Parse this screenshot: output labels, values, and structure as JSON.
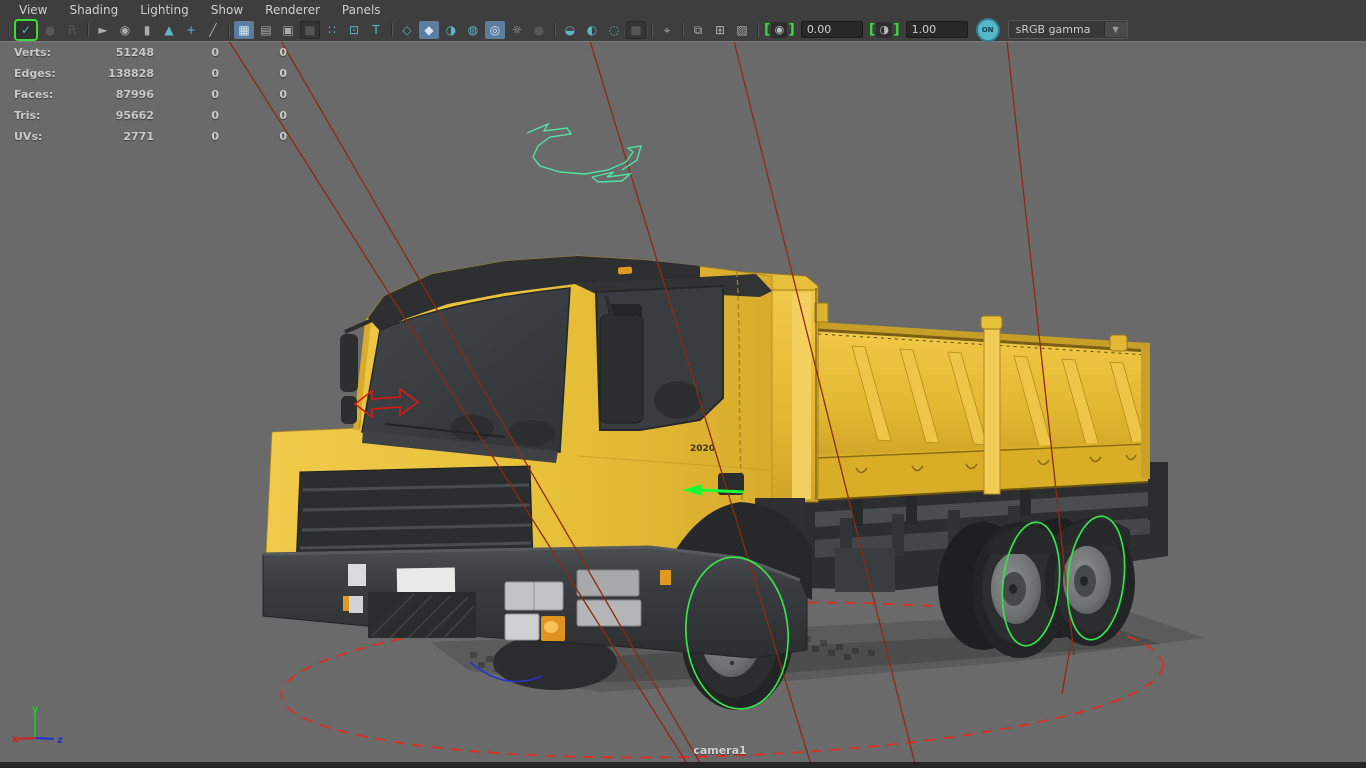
{
  "menu_bar": {
    "items": [
      "View",
      "Shading",
      "Lighting",
      "Show",
      "Renderer",
      "Panels"
    ]
  },
  "toolbar": {
    "items": [
      {
        "kind": "sep"
      },
      {
        "kind": "icon",
        "name": "look-through-selected-icon",
        "glyph": "✓",
        "state": "green-border"
      },
      {
        "kind": "icon",
        "name": "render-region-icon",
        "glyph": "●",
        "state": "dim"
      },
      {
        "kind": "icon",
        "name": "snapshot-icon",
        "glyph": "R",
        "state": "dim"
      },
      {
        "kind": "sep"
      },
      {
        "kind": "icon",
        "name": "select-camera-icon",
        "glyph": "►",
        "state": "gray"
      },
      {
        "kind": "icon",
        "name": "camera-attributes-icon",
        "glyph": "◉",
        "state": "gray"
      },
      {
        "kind": "icon",
        "name": "bookmark-icon",
        "glyph": "▮",
        "state": "gray"
      },
      {
        "kind": "icon",
        "name": "image-plane-icon",
        "glyph": "▲",
        "state": "teal"
      },
      {
        "kind": "icon",
        "name": "pan-zoom-icon",
        "glyph": "+",
        "state": "teal"
      },
      {
        "kind": "icon",
        "name": "measure-tool-icon",
        "glyph": "╱",
        "state": "gray"
      },
      {
        "kind": "sep"
      },
      {
        "kind": "icon",
        "name": "grid-icon",
        "glyph": "▦",
        "state": "active"
      },
      {
        "kind": "icon",
        "name": "film-gate-icon",
        "glyph": "▤",
        "state": "gray"
      },
      {
        "kind": "icon",
        "name": "resolution-gate-icon",
        "glyph": "▣",
        "state": "gray"
      },
      {
        "kind": "icon",
        "name": "gate-mask-icon",
        "glyph": "■",
        "state": "pressed"
      },
      {
        "kind": "icon",
        "name": "field-chart-icon",
        "glyph": "∷",
        "state": "teal"
      },
      {
        "kind": "icon",
        "name": "safe-action-icon",
        "glyph": "⊡",
        "state": "teal"
      },
      {
        "kind": "icon",
        "name": "safe-title-icon",
        "glyph": "T",
        "state": "teal"
      },
      {
        "kind": "sep"
      },
      {
        "kind": "icon",
        "name": "wireframe-icon",
        "glyph": "◇",
        "state": "teal"
      },
      {
        "kind": "icon",
        "name": "smooth-shade-icon",
        "glyph": "◆",
        "state": "active"
      },
      {
        "kind": "icon",
        "name": "flat-shade-icon",
        "glyph": "◑",
        "state": "teal"
      },
      {
        "kind": "icon",
        "name": "textured-icon",
        "glyph": "◍",
        "state": "teal"
      },
      {
        "kind": "icon",
        "name": "use-all-lights-icon",
        "glyph": "◎",
        "state": "active"
      },
      {
        "kind": "icon",
        "name": "default-lighting-icon",
        "glyph": "☼",
        "state": "gray"
      },
      {
        "kind": "icon",
        "name": "shadows-icon",
        "glyph": "●",
        "state": "dim"
      },
      {
        "kind": "sep"
      },
      {
        "kind": "icon",
        "name": "occlusion-icon",
        "glyph": "◒",
        "state": "teal"
      },
      {
        "kind": "icon",
        "name": "motion-blur-icon",
        "glyph": "◐",
        "state": "teal"
      },
      {
        "kind": "icon",
        "name": "anti-alias-icon",
        "glyph": "◌",
        "state": "teal"
      },
      {
        "kind": "icon",
        "name": "depth-of-field-icon",
        "glyph": "■",
        "state": "pressed"
      },
      {
        "kind": "sep"
      },
      {
        "kind": "icon",
        "name": "object-select-icon",
        "glyph": "⌖",
        "state": "gray"
      },
      {
        "kind": "sep"
      },
      {
        "kind": "icon",
        "name": "isolate-select-icon",
        "glyph": "⧉",
        "state": "gray"
      },
      {
        "kind": "icon",
        "name": "tear-off-copy-icon",
        "glyph": "⊞",
        "state": "gray"
      },
      {
        "kind": "icon",
        "name": "image-output-icon",
        "glyph": "▨",
        "state": "gray"
      },
      {
        "kind": "sep"
      },
      {
        "kind": "bracket",
        "name": "exposure-icon",
        "glyph": "◉"
      },
      {
        "kind": "field",
        "name": "exposure-field",
        "value": "0.00"
      },
      {
        "kind": "bracket",
        "name": "contrast-icon",
        "glyph": "◑"
      },
      {
        "kind": "field",
        "name": "contrast-field",
        "value": "1.00"
      },
      {
        "kind": "toggle",
        "name": "gamma-toggle",
        "label": "ON"
      },
      {
        "kind": "dropdown",
        "name": "colorspace-dropdown",
        "label": "sRGB gamma"
      }
    ]
  },
  "hud": {
    "rows": [
      {
        "label": "Verts:",
        "value": "51248",
        "col1": "0",
        "col2": "0"
      },
      {
        "label": "Edges:",
        "value": "138828",
        "col1": "0",
        "col2": "0"
      },
      {
        "label": "Faces:",
        "value": "87996",
        "col1": "0",
        "col2": "0"
      },
      {
        "label": "Tris:",
        "value": "95662",
        "col1": "0",
        "col2": "0"
      },
      {
        "label": "UVs:",
        "value": "2771",
        "col1": "0",
        "col2": "0"
      }
    ]
  },
  "viewport": {
    "camera_label": "camera1",
    "truck_door_label": "2020",
    "axis": {
      "x": "x",
      "y": "y",
      "z": "z"
    },
    "colors": {
      "background": "#6a6a6a",
      "truck_yellow": "#e8c13a",
      "cab_dark": "#2d2f31",
      "selection_green": "#35e44b",
      "curve_teal": "#4fe2a0",
      "frustum_red": "#8c2a12",
      "dashed_red": "#de2e1e",
      "annotation_red": "#d81b12",
      "arc_blue": "#2a35c8",
      "axis_x": "#cc2222",
      "axis_y": "#22bb22",
      "axis_z": "#2233cc"
    }
  }
}
